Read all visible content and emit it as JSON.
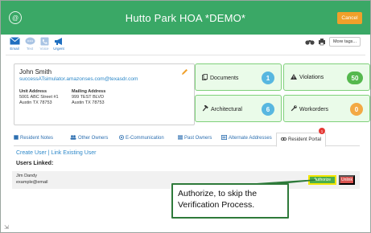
{
  "header": {
    "title": "Hutto Park HOA *DEMO*",
    "cancel_label": "Cancel",
    "logo_icon": "at-sign-icon",
    "color": "#3aa866"
  },
  "toolbar": {
    "items": [
      {
        "label": "Email",
        "icon": "envelope-icon"
      },
      {
        "label": "Text",
        "icon": "chat-bubble-icon"
      },
      {
        "label": "Voice",
        "icon": "phone-icon"
      },
      {
        "label": "Urgent",
        "icon": "megaphone-icon"
      }
    ],
    "more_tags_label": "More tags..."
  },
  "owner": {
    "name": "John Smith",
    "email": "successATsimulator.amazonses.com@texasdr.com",
    "unit_address_label": "Unit Address",
    "unit_address_line1": "5001 ABC Street #1",
    "unit_address_line2": "Austin TX 78753",
    "mailing_address_label": "Mailing Address",
    "mailing_address_line1": "999 TEST BLVD",
    "mailing_address_line2": "Austin TX 78753"
  },
  "tiles": {
    "documents": {
      "label": "Documents",
      "count": "1"
    },
    "violations": {
      "label": "Violations",
      "count": "50"
    },
    "architectural": {
      "label": "Architectural",
      "count": "6"
    },
    "workorders": {
      "label": "Workorders",
      "count": "0"
    }
  },
  "tabs": {
    "resident_notes": "Resident Notes",
    "other_owners": "Other Owners",
    "e_communication": "E-Communication",
    "past_owners": "Past Owners",
    "alternate_addresses": "Alternate Addresses",
    "resident_portal": "Resident Portal",
    "resident_portal_badge": "1"
  },
  "users": {
    "create_user": "Create User",
    "separator": "|",
    "link_existing_user": "Link Existing User",
    "heading": "Users Linked:",
    "rows": [
      {
        "name": "Jim Dandy",
        "email": "example@email",
        "authorize_label": "Authorize",
        "unlink_label": "Unlink"
      }
    ]
  },
  "callout": {
    "text": "Authorize, to skip the Verification Process."
  }
}
